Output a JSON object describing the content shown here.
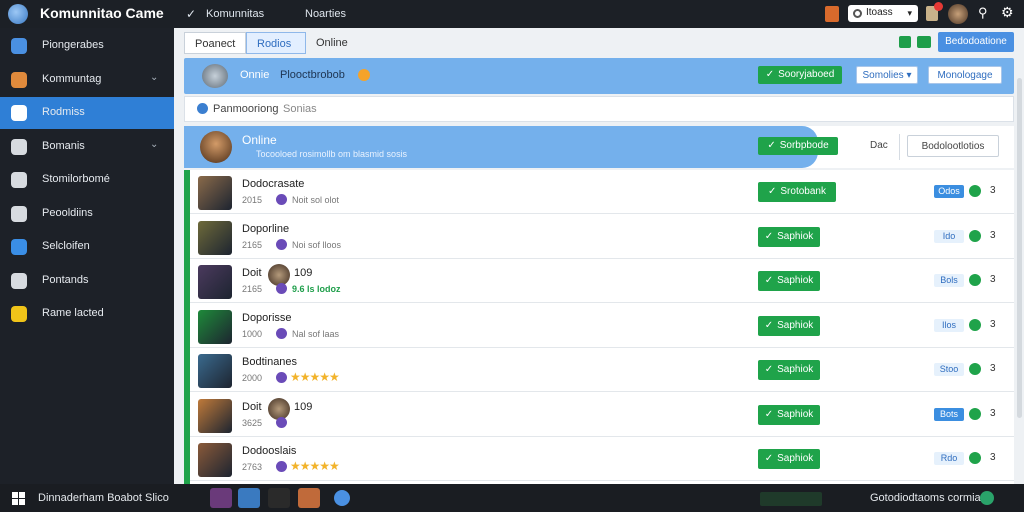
{
  "app": {
    "title": "Komunnitao Came"
  },
  "topbar": {
    "nav": [
      "Komunnitas",
      "Noarties"
    ],
    "search_value": "Itoass"
  },
  "sidebar": {
    "items": [
      {
        "label": "Piongerabes",
        "icon": "community-icon",
        "color": "#4a90e2"
      },
      {
        "label": "Kommuntag",
        "icon": "game-icon",
        "color": "#e08a3c",
        "chevron": true
      },
      {
        "label": "Rodmiss",
        "icon": "cat-icon",
        "color": "#ffffff",
        "active": true
      },
      {
        "label": "Bomanis",
        "icon": "grid-icon",
        "color": "#d7dbe0",
        "chevron": true
      },
      {
        "label": "Stomilorbomé",
        "icon": "headset-icon",
        "color": "#d7dbe0"
      },
      {
        "label": "Peooldiins",
        "icon": "chat-icon",
        "color": "#d7dbe0"
      },
      {
        "label": "Selcloifen",
        "icon": "globe-icon",
        "color": "#3a8ee6"
      },
      {
        "label": "Pontands",
        "icon": "window-icon",
        "color": "#d7dbe0"
      },
      {
        "label": "Rame lacted",
        "icon": "smile-icon",
        "color": "#f0c419"
      }
    ]
  },
  "tabs": [
    "Poanect",
    "Rodios",
    "Online"
  ],
  "top_button": "Bedodoatione",
  "banner": {
    "label": "Onnie",
    "sub": "Plooctbrobob",
    "green_btn": "Sooryjaboed",
    "dropdown": "Somolies",
    "white_btn": "Monologage"
  },
  "filter": {
    "label": "Panmooriong",
    "chip": "Sonias"
  },
  "online": {
    "title": "Online",
    "sub": "Tocooloed rosimollb om blasmid sosis",
    "green_btn": "Sorbpbode",
    "side_label": "Dac",
    "white_btn": "Bodolootlotios"
  },
  "rows": [
    {
      "title": "Dodocrasate",
      "num": "2015",
      "sub": "Noit sol olot",
      "btn": "Srotobank",
      "mini": "Odos",
      "mini_solid": true,
      "count": "3",
      "thumb": "#8a6a4a"
    },
    {
      "title": "Doporline",
      "num": "2165",
      "sub": "Noi sof lloos",
      "btn": "Saphiok",
      "mini": "Ido",
      "mini_solid": false,
      "count": "3",
      "thumb": "#6e6a3a"
    },
    {
      "title": "Doit",
      "extra": "109",
      "num": "2165",
      "sub": "9.6 ls lodoz",
      "sub_green": true,
      "btn": "Saphiok",
      "mini": "Bols",
      "mini_solid": false,
      "count": "3",
      "thumb": "#4b3a5e",
      "avatar": true
    },
    {
      "title": "Doporisse",
      "num": "1000",
      "sub": "Nal sof laas",
      "btn": "Saphiok",
      "mini": "Ilos",
      "mini_solid": false,
      "count": "3",
      "thumb": "#1e8a3a"
    },
    {
      "title": "Bodtinanes",
      "num": "2000",
      "stars": "★★★★★",
      "btn": "Saphiok",
      "mini": "Stoo",
      "mini_solid": false,
      "count": "3",
      "thumb": "#3a6a8e"
    },
    {
      "title": "Doit",
      "extra": "109",
      "num": "3625",
      "btn": "Saphiok",
      "mini": "Bots",
      "mini_solid": true,
      "count": "3",
      "thumb": "#c07a3a",
      "avatar": true
    },
    {
      "title": "Dodooslais",
      "num": "2763",
      "stars": "★★★★★",
      "btn": "Saphiok",
      "mini": "Rdo",
      "mini_solid": false,
      "count": "3",
      "thumb": "#8a5a3a"
    }
  ],
  "taskbar": {
    "text": "Dinnaderham Boabot Slico",
    "status": "Gotodiodtaoms cormias"
  }
}
